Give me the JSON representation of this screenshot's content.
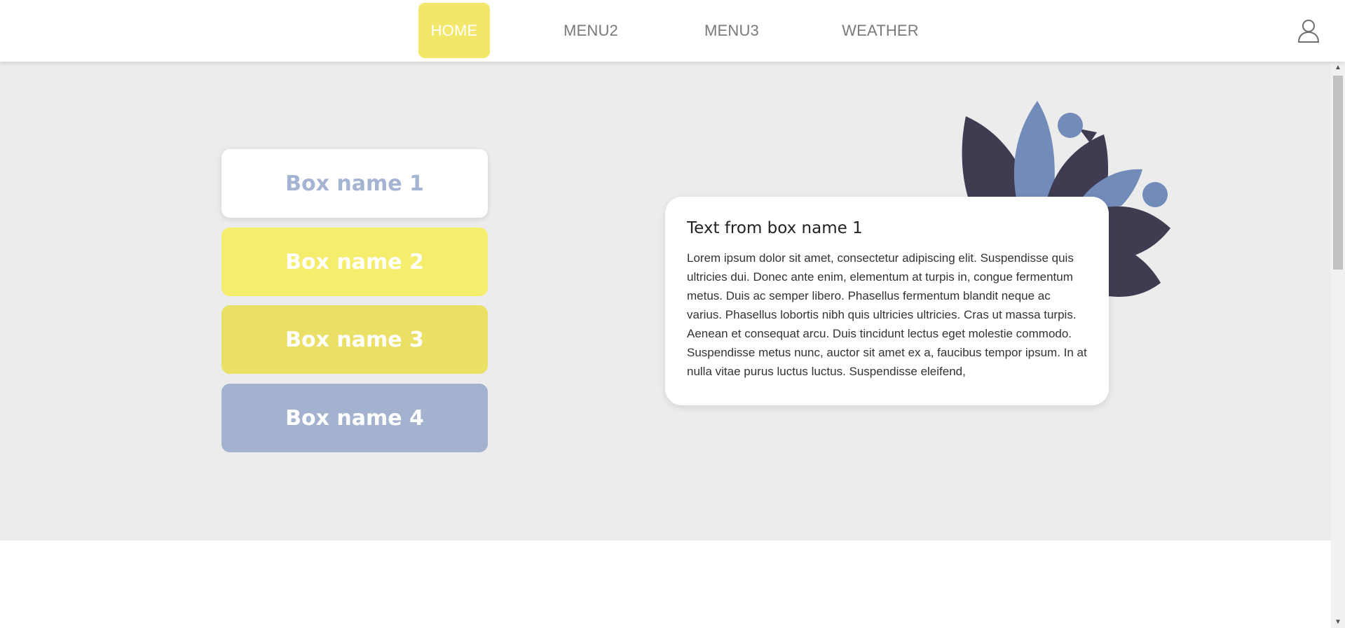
{
  "nav": {
    "items": [
      {
        "label": "HOME",
        "active": true
      },
      {
        "label": "MENU2",
        "active": false
      },
      {
        "label": "MENU3",
        "active": false
      },
      {
        "label": "WEATHER",
        "active": false
      }
    ],
    "user_icon": "user-icon"
  },
  "boxes": [
    {
      "label": "Box name 1",
      "color": "#ffffff",
      "text_color": "#a4b4d2"
    },
    {
      "label": "Box name 2",
      "color": "#f5ee6c"
    },
    {
      "label": "Box name 3",
      "color": "#e9e065"
    },
    {
      "label": "Box name 4",
      "color": "#a2b2cf"
    }
  ],
  "card": {
    "title": "Text from box name 1",
    "body": "Lorem ipsum dolor sit amet, consectetur adipiscing elit. Suspendisse quis ultricies dui. Donec ante enim, elementum at turpis in, congue fermentum metus. Duis ac semper libero. Phasellus fermentum blandit neque ac varius. Phasellus lobortis nibh quis ultricies ultricies. Cras ut massa turpis. Aenean et consequat arcu. Duis tincidunt lectus eget molestie commodo. Suspendisse metus nunc, auctor sit amet ex a, faucibus tempor ipsum. In at nulla vitae purus luctus luctus. Suspendisse eleifend,"
  },
  "colors": {
    "accent_yellow": "#f2e76a",
    "hero_bg": "#ececed",
    "petal_dark": "#3f3c52",
    "petal_blue": "#728bb9"
  }
}
